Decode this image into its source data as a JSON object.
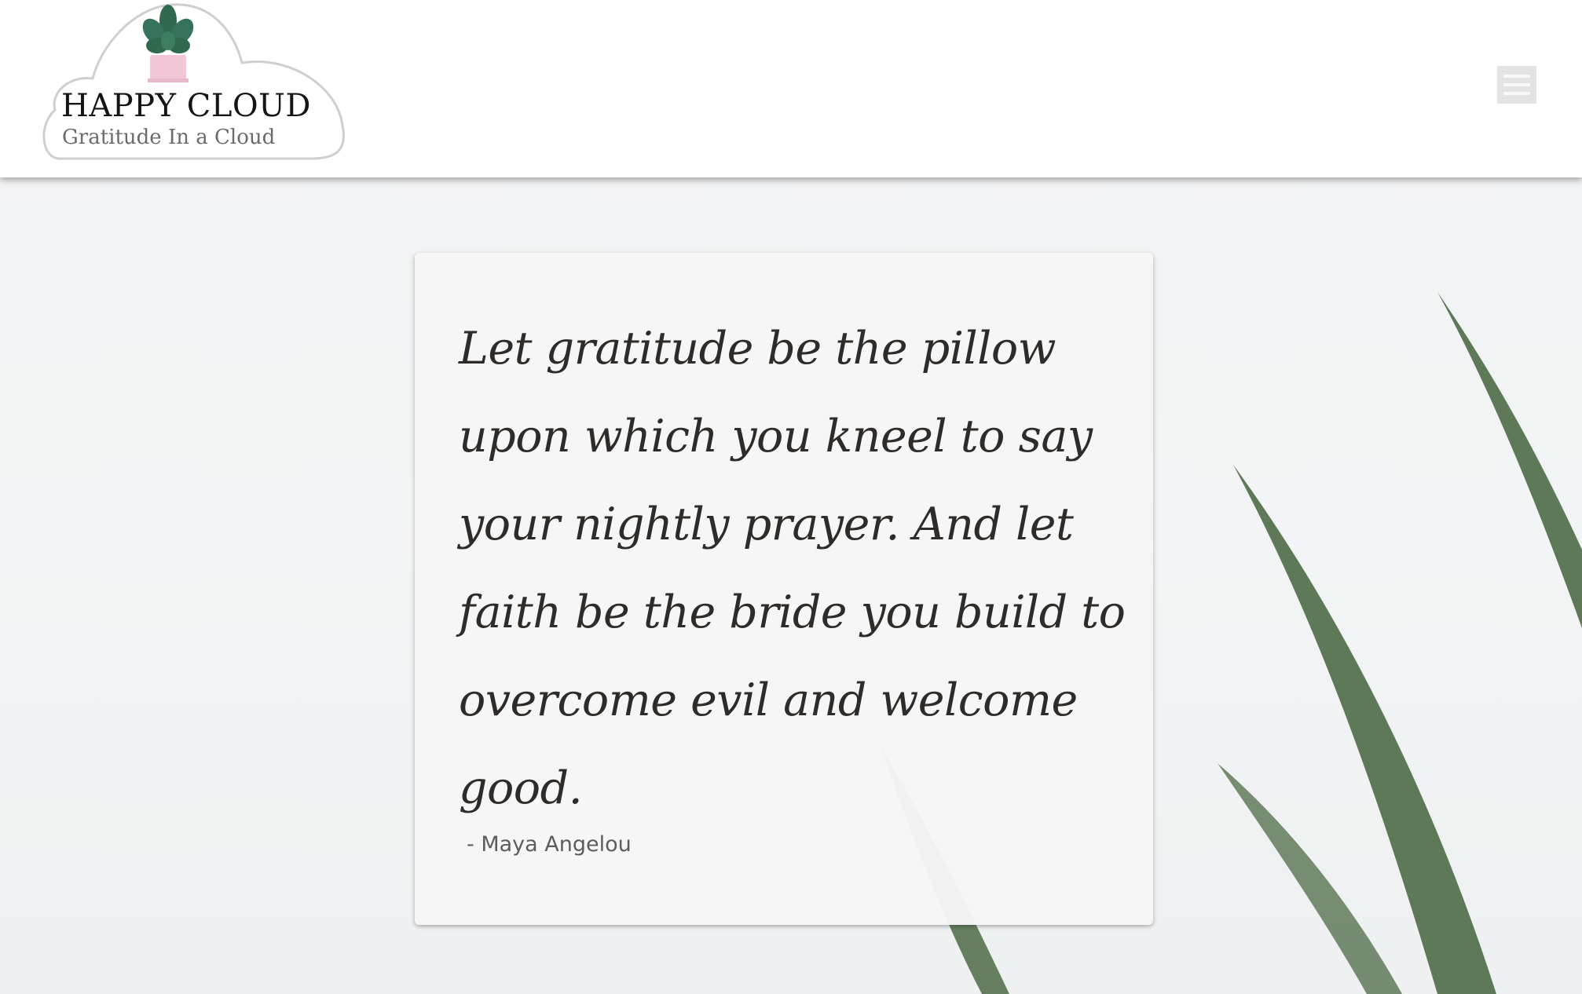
{
  "brand": {
    "name": "HAPPY CLOUD",
    "tagline": "Gratitude In a Cloud",
    "logo_icon": "potted-plant-icon",
    "colors": {
      "leaf": "#2f6a4f",
      "pot": "#f1c6d6",
      "cloud_outline": "#cfcfcf"
    }
  },
  "header": {
    "menu_icon": "hamburger-menu-icon"
  },
  "quote": {
    "text": "Let gratitude be the pillow upon which you kneel to say your nightly prayer. And let faith be the bride you build to overcome evil and welcome good.",
    "author": "- Maya Angelou"
  },
  "background": {
    "decoration": "palm-leaves",
    "leaf_color": "#4d6b47"
  }
}
